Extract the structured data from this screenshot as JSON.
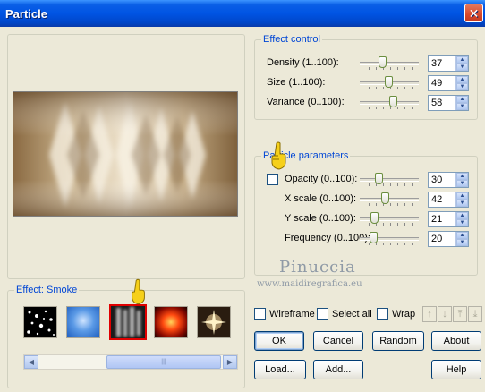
{
  "window": {
    "title": "Particle",
    "close_label": "✕"
  },
  "effect_control": {
    "title": "Effect control",
    "rows": [
      {
        "label": "Density (1..100):",
        "value": "37",
        "level": 37
      },
      {
        "label": "Size (1..100):",
        "value": "49",
        "level": 49
      },
      {
        "label": "Variance (0..100):",
        "value": "58",
        "level": 58
      }
    ]
  },
  "particle_parameters": {
    "title": "Particle parameters",
    "rows": [
      {
        "label": "Opacity (0..100):",
        "value": "30",
        "level": 30
      },
      {
        "label": "X scale (0..100):",
        "value": "42",
        "level": 42
      },
      {
        "label": "Y scale (0..100):",
        "value": "21",
        "level": 21
      },
      {
        "label": "Frequency (0..100):",
        "value": "20",
        "level": 20
      }
    ]
  },
  "effect_group": {
    "title": "Effect: Smoke",
    "thumbnails": [
      "stars",
      "sky",
      "smoke",
      "fire",
      "sparkle"
    ],
    "selected": "smoke"
  },
  "watermark": {
    "name": "Pinuccia",
    "site": "www.maidiregrafica.eu"
  },
  "options": {
    "wireframe": "Wireframe",
    "select_all": "Select all",
    "wrap": "Wrap"
  },
  "buttons": {
    "ok": "OK",
    "cancel": "Cancel",
    "random": "Random",
    "about": "About",
    "load": "Load...",
    "add": "Add...",
    "help": "Help"
  },
  "arrow_buttons": [
    "↑",
    "↓",
    "⤒",
    "⤓"
  ],
  "scrollbar": {
    "grip": "|||"
  },
  "colors": {
    "accent": "#0046d5",
    "selected_border": "#e00000",
    "titlebar": "#0054e3"
  }
}
